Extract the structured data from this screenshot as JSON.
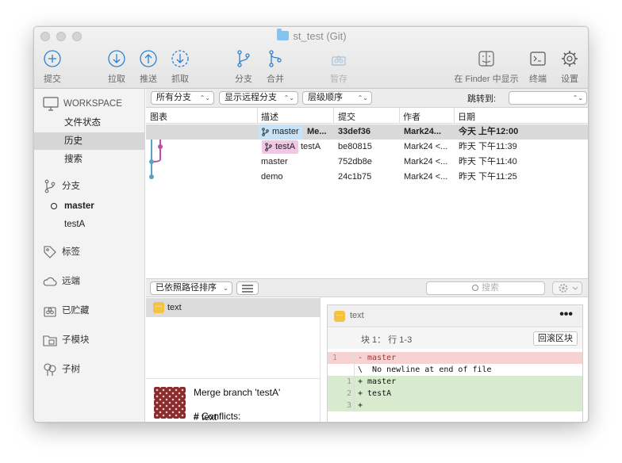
{
  "window": {
    "title": "st_test (Git)"
  },
  "toolbar": {
    "commit": "提交",
    "pull": "拉取",
    "push": "推送",
    "fetch": "抓取",
    "branch": "分支",
    "merge": "合并",
    "stash": "暂存",
    "finder": "在 Finder 中显示",
    "terminal": "终端",
    "settings": "设置"
  },
  "sidebar": {
    "workspace": "WORKSPACE",
    "workspace_items": [
      "文件状态",
      "历史",
      "搜索"
    ],
    "selected_item": "历史",
    "branches_header": "分支",
    "branches": [
      {
        "name": "master",
        "current": true
      },
      {
        "name": "testA",
        "current": false
      }
    ],
    "tags": "标签",
    "remotes": "远端",
    "stashes": "已贮藏",
    "submodules": "子模块",
    "subtrees": "子树"
  },
  "filters": {
    "branches": "所有分支",
    "remote": "显示远程分支",
    "order": "层级顺序",
    "jump_label": "跳转到:",
    "jump_value": ""
  },
  "columns": {
    "graph": "图表",
    "description": "描述",
    "commit": "提交",
    "author": "作者",
    "date": "日期"
  },
  "commits": [
    {
      "tag": "master",
      "tag_color": "#c7e3f7",
      "description": "Me...",
      "hash": "33def36",
      "author": "Mark24...",
      "date": "今天 上午12:00",
      "bold": true
    },
    {
      "tag": "testA",
      "tag_color": "#f1c6e6",
      "description": "testA",
      "hash": "be80815",
      "author": "Mark24 <...",
      "date": "昨天 下午11:39",
      "bold": false
    },
    {
      "tag": "",
      "description": "master",
      "hash": "752db8e",
      "author": "Mark24 <...",
      "date": "昨天 下午11:40",
      "bold": false
    },
    {
      "tag": "",
      "description": "demo",
      "hash": "24c1b75",
      "author": "Mark24 <...",
      "date": "昨天 下午11:25",
      "bold": false
    }
  ],
  "files_bar": {
    "sort": "已依照路径排序",
    "search_placeholder": "搜索"
  },
  "files": [
    {
      "name": "text"
    }
  ],
  "commit_message": [
    "Merge branch 'testA'",
    "# Conflicts:",
    "# text"
  ],
  "diff": {
    "file": "text",
    "hunk": "块 1： 行 1-3",
    "rollback": "回滚区块",
    "lines": [
      {
        "old": "1",
        "new": "",
        "type": "del",
        "text": "- master"
      },
      {
        "old": "",
        "new": "",
        "type": "ctx",
        "text": "\\  No newline at end of file"
      },
      {
        "old": "",
        "new": "1",
        "type": "add",
        "text": "+ master"
      },
      {
        "old": "",
        "new": "2",
        "type": "add",
        "text": "+ testA"
      },
      {
        "old": "",
        "new": "3",
        "type": "add",
        "text": "+"
      }
    ]
  },
  "colors": {
    "del_bg": "#f7d2d2",
    "add_bg": "#d8ebcf",
    "graph_blue": "#5a9fc4",
    "graph_pink": "#c04cab"
  }
}
